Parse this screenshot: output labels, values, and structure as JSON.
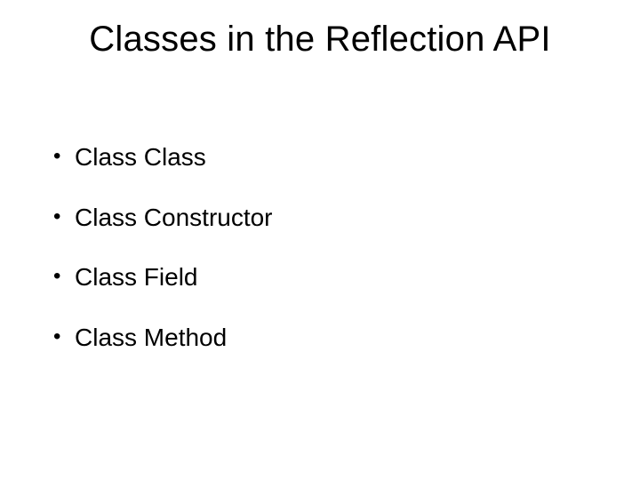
{
  "title": "Classes in the Reflection API",
  "bullets": [
    "Class Class",
    "Class Constructor",
    "Class Field",
    "Class Method"
  ],
  "bullet_glyph": "•"
}
